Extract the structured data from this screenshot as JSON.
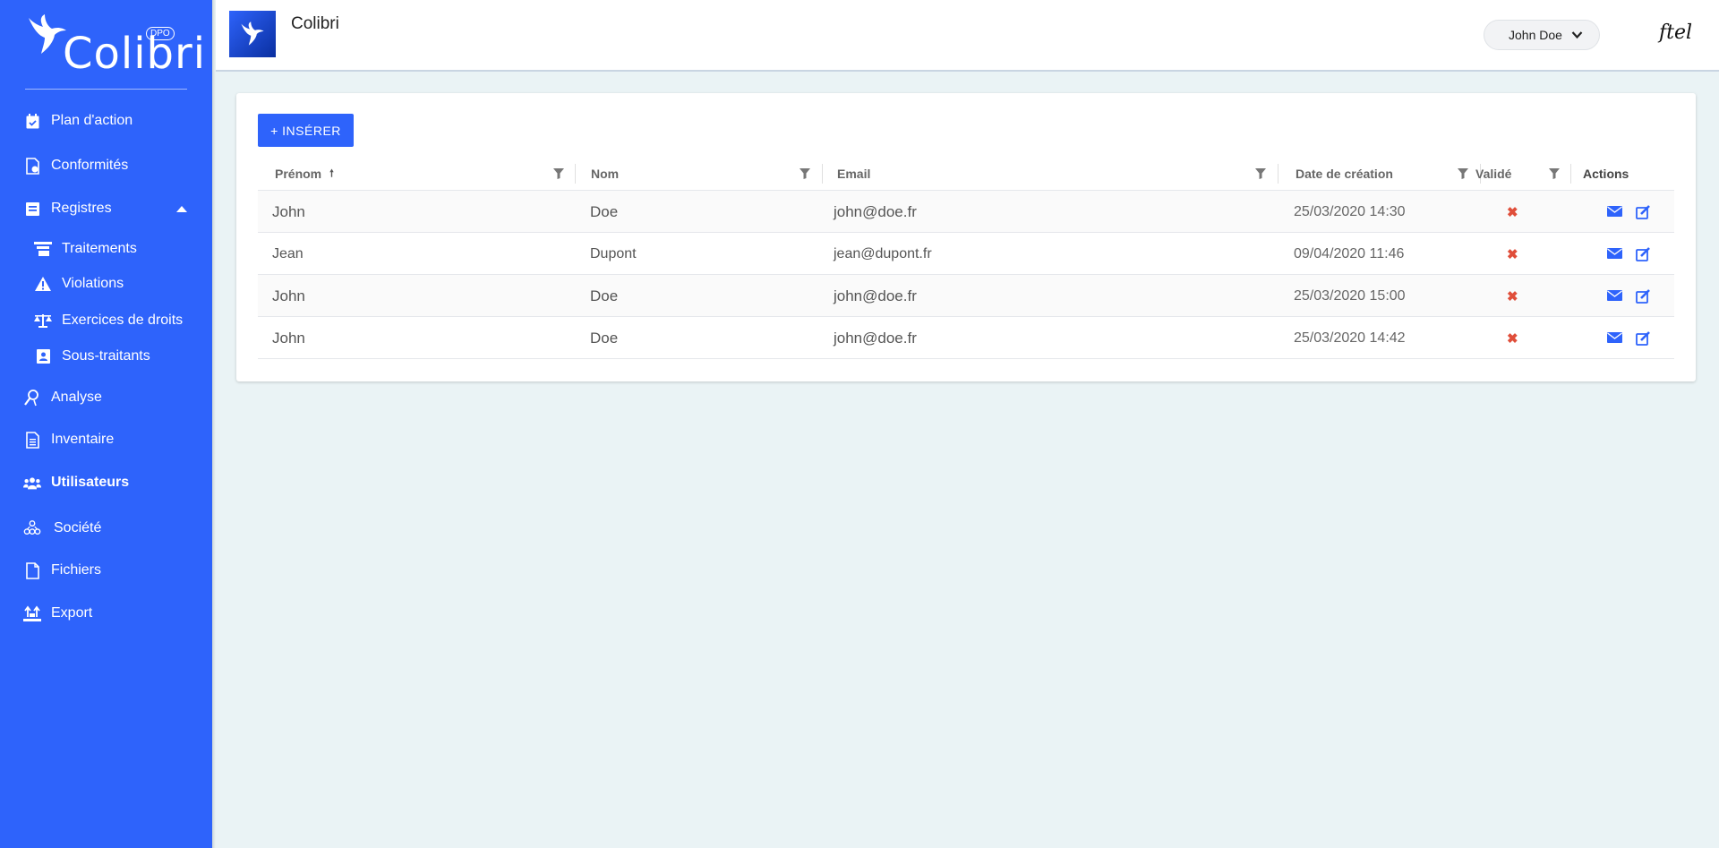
{
  "app": {
    "logo_text": "Colibri",
    "logo_badge": "DPO",
    "title": "Colibri"
  },
  "sidebar": {
    "items": [
      {
        "label": "Plan d'action",
        "icon": "calendar-check-icon"
      },
      {
        "label": "Conformités",
        "icon": "document-check-icon"
      },
      {
        "label": "Registres",
        "icon": "registry-icon"
      },
      {
        "label": "Traitements",
        "icon": "stack-icon"
      },
      {
        "label": "Violations",
        "icon": "warning-icon"
      },
      {
        "label": "Exercices de droits",
        "icon": "balance-icon"
      },
      {
        "label": "Sous-traitants",
        "icon": "contact-card-icon"
      },
      {
        "label": "Analyse",
        "icon": "analysis-icon"
      },
      {
        "label": "Inventaire",
        "icon": "document-icon"
      },
      {
        "label": "Utilisateurs",
        "icon": "users-icon"
      },
      {
        "label": "Société",
        "icon": "organization-icon"
      },
      {
        "label": "Fichiers",
        "icon": "files-icon"
      },
      {
        "label": "Export",
        "icon": "export-icon"
      }
    ]
  },
  "header": {
    "user_name": "John Doe",
    "brand": "ftel"
  },
  "toolbar": {
    "insert_label": "+ INSÉRER"
  },
  "table": {
    "columns": [
      "Prénom",
      "Nom",
      "Email",
      "Date de création",
      "Validé",
      "Actions"
    ],
    "rows": [
      {
        "prenom": "John",
        "nom": "Doe",
        "email": "john@doe.fr",
        "date": "25/03/2020 14:30",
        "valide": "✖"
      },
      {
        "prenom": "Jean",
        "nom": "Dupont",
        "email": "jean@dupont.fr",
        "date": "09/04/2020 11:46",
        "valide": "✖"
      },
      {
        "prenom": "John",
        "nom": "Doe",
        "email": "john@doe.fr",
        "date": "25/03/2020 15:00",
        "valide": "✖"
      },
      {
        "prenom": "John",
        "nom": "Doe",
        "email": "john@doe.fr",
        "date": "25/03/2020 14:42",
        "valide": "✖"
      }
    ]
  },
  "colors": {
    "primary": "#2e63fb",
    "background": "#eaf3f5",
    "invalid": "#e04e3a"
  }
}
